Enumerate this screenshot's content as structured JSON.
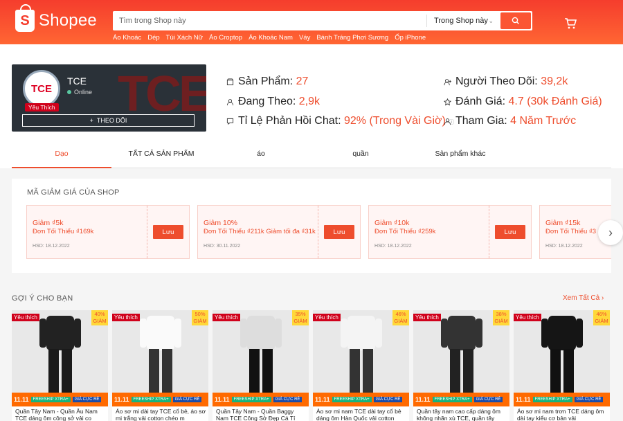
{
  "header": {
    "logo_text": "Shopee",
    "search_placeholder": "Tìm trong Shop này",
    "search_scope": "Trong Shop này",
    "keywords": [
      "Áo Khoác",
      "Dép",
      "Túi Xách Nữ",
      "Áo Croptop",
      "Áo Khoác Nam",
      "Váy",
      "Bánh Tráng Phơi Sương",
      "Ốp iPhone"
    ]
  },
  "shop": {
    "name": "TCE",
    "status": "Online",
    "favorite_badge": "Yêu Thích",
    "follow_label": "THEO DÕI",
    "avatar_text": "TCE",
    "banner_text": "TCE"
  },
  "stats": {
    "products_label": "Sản Phẩm:",
    "products_value": "27",
    "following_label": "Đang Theo:",
    "following_value": "2,9k",
    "chat_label": "Tỉ Lệ Phản Hồi Chat:",
    "chat_value": "92% (Trong Vài Giờ)",
    "followers_label": "Người Theo Dõi:",
    "followers_value": "39,2k",
    "rating_label": "Đánh Giá:",
    "rating_value": "4.7 (30k Đánh Giá)",
    "joined_label": "Tham Gia:",
    "joined_value": "4 Năm Trước"
  },
  "tabs": [
    "Dạo",
    "TẤT CẢ SẢN PHẨM",
    "áo",
    "quần",
    "Sản phẩm khác"
  ],
  "vouchers": {
    "title": "MÃ GIẢM GIÁ CỦA SHOP",
    "items": [
      {
        "amount": "Giảm ₫5k",
        "condition": "Đơn Tối Thiểu ₫169k",
        "expiry": "HSD: 18.12.2022",
        "button": "Lưu"
      },
      {
        "amount": "Giảm 10%",
        "condition": "Đơn Tối Thiểu ₫211k Giảm tối đa ₫31k",
        "expiry": "HSD: 30.11.2022",
        "button": "Lưu"
      },
      {
        "amount": "Giảm ₫10k",
        "condition": "Đơn Tối Thiểu ₫259k",
        "expiry": "HSD: 18.12.2022",
        "button": "Lưu"
      },
      {
        "amount": "Giảm ₫15k",
        "condition": "Đơn Tối Thiểu ₫3",
        "expiry": "HSD: 18.12.2022",
        "button": "Lưu"
      }
    ]
  },
  "recommend": {
    "title": "GỢI Ý CHO BẠN",
    "see_all": "Xem Tất Cả",
    "products": [
      {
        "fav": "Yêu thích",
        "discount": "40%",
        "discount_label": "GIẢM",
        "name": "Quần Tây Nam - Quần Âu Nam TCE dáng ôm công sở vải co",
        "shirt": "#222",
        "pants": "#1a1a1a"
      },
      {
        "fav": "Yêu thích",
        "discount": "50%",
        "discount_label": "GIẢM",
        "name": "Áo sơ mi dài tay TCE cổ bẻ, áo sơ mi trắng vải cotton chéo m",
        "shirt": "#fafafa",
        "pants": "#333"
      },
      {
        "fav": "Yêu thích",
        "discount": "35%",
        "discount_label": "GIẢM",
        "name": "Quần Tây Nam - Quần Baggy Nam TCE Công Sở Đẹp Cá Tí",
        "shirt": "#ddd",
        "pants": "#111"
      },
      {
        "fav": "Yêu thích",
        "discount": "46%",
        "discount_label": "GIẢM",
        "name": "Áo sơ mi nam TCE dài tay cổ bẻ dáng ôm Hàn Quốc vải cotton",
        "shirt": "#f4f4f4",
        "pants": "#333"
      },
      {
        "fav": "Yêu thích",
        "discount": "38%",
        "discount_label": "GIẢM",
        "name": "Quần tây nam cao cấp dáng ôm không nhăn xù TCE, quần tây",
        "shirt": "#333",
        "pants": "#222"
      },
      {
        "fav": "Yêu thích",
        "discount": "46%",
        "discount_label": "GIẢM",
        "name": "Áo sơ mi nam trơn TCE dáng ôm dài tay kiểu cơ bản vải",
        "shirt": "#151515",
        "pants": "#111"
      }
    ],
    "strip": {
      "eleven": "11.11",
      "freeship": "FREESHIP XTRA+",
      "cheap": "GIÁ CỰC RẺ"
    }
  },
  "colors": {
    "brand": "#ee4d2d",
    "header": "#f53d2d"
  }
}
